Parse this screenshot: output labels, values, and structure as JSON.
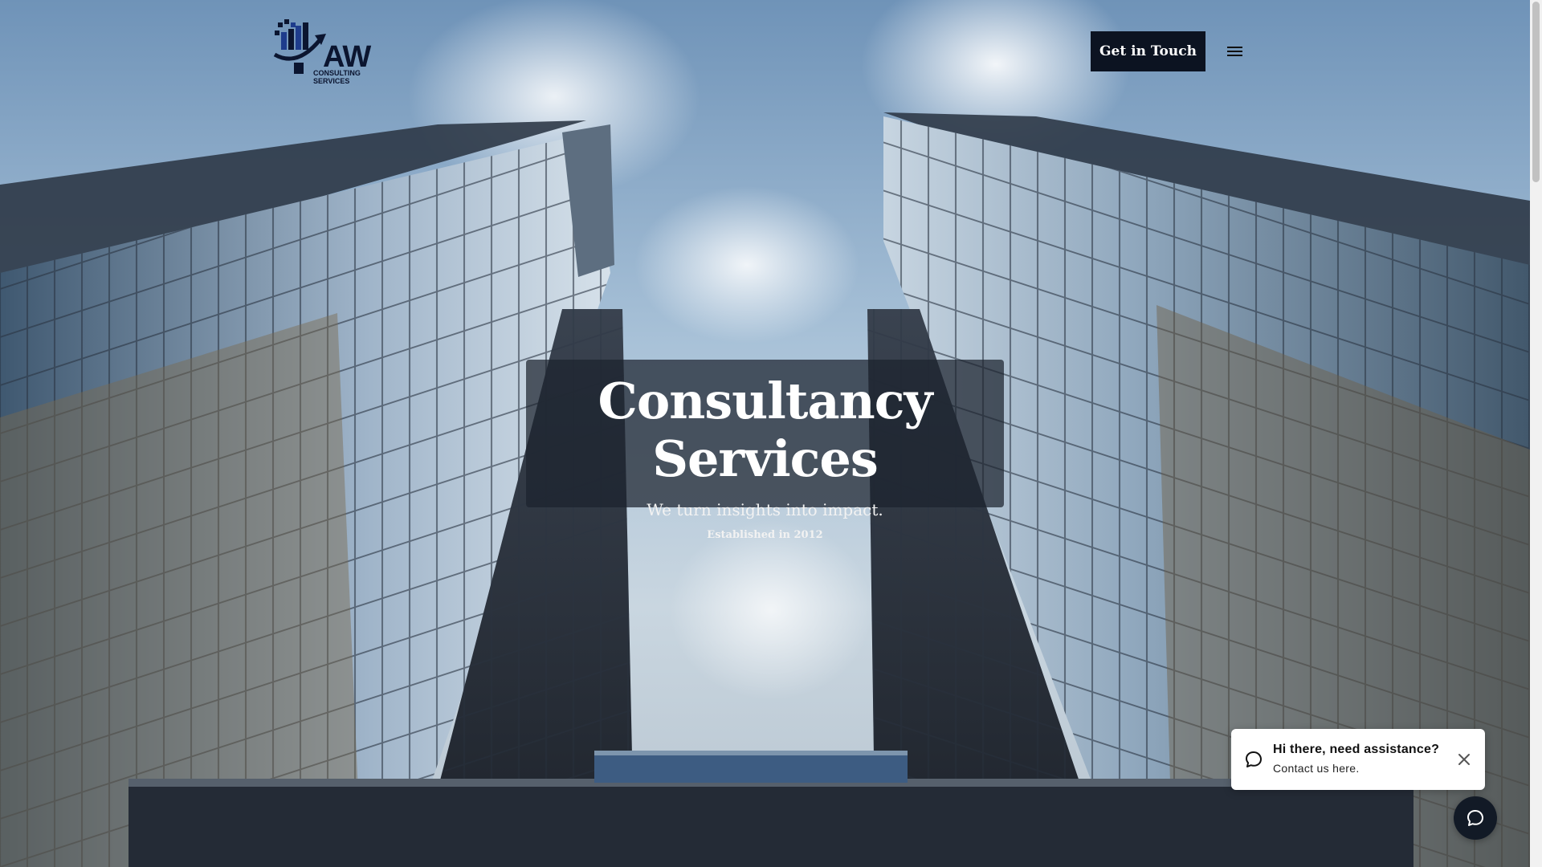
{
  "header": {
    "logo": {
      "text_big": "AW",
      "text_small_line1": "CONSULTING",
      "text_small_line2": "SERVICES"
    },
    "cta_label": "Get in Touch",
    "menu_icon": "hamburger-menu-icon"
  },
  "hero": {
    "title": "Consultancy Services",
    "subtitle": "We turn insights into impact.",
    "established": "Established in 2012"
  },
  "chat": {
    "title": "Hi there, need assistance?",
    "subtitle": "Contact us here.",
    "bubble_icon": "chat-bubble-icon",
    "close_icon": "close-icon",
    "fab_icon": "chat-bubble-icon"
  },
  "colors": {
    "cta_bg": "#0c1321",
    "title_box_bg": "#1c222e",
    "chat_fab_bg": "#121a26"
  }
}
